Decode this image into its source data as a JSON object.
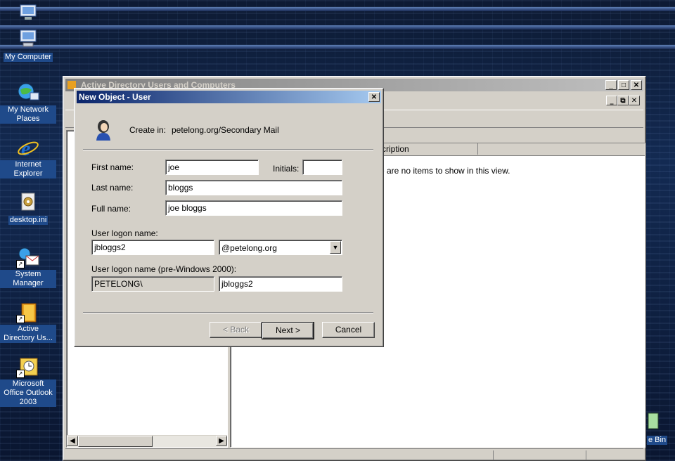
{
  "desktop": {
    "icons": [
      {
        "label": "My Computer"
      },
      {
        "label": "My Network Places"
      },
      {
        "label": "Internet Explorer"
      },
      {
        "label": "desktop.ini"
      },
      {
        "label": "System Manager"
      },
      {
        "label": "Active Directory Us..."
      },
      {
        "label": "Microsoft Office Outlook 2003"
      },
      {
        "label": "e Bin"
      }
    ]
  },
  "mmc": {
    "title": "Active Directory Users and Computers",
    "column_header": "scription",
    "empty_message": "re are no items to show in this view."
  },
  "dialog": {
    "title": "New Object - User",
    "create_in_label": "Create in:",
    "create_in_value": "petelong.org/Secondary Mail",
    "first_name_label": "First name:",
    "first_name_value": "joe",
    "initials_label": "Initials:",
    "initials_value": "",
    "last_name_label": "Last name:",
    "last_name_value": "bloggs",
    "full_name_label": "Full name:",
    "full_name_value": "joe bloggs",
    "logon_label": "User logon name:",
    "logon_value": "jbloggs2",
    "domain_value": "@petelong.org",
    "prewin_label": "User logon name (pre-Windows 2000):",
    "prewin_domain": "PETELONG\\",
    "prewin_value": "jbloggs2",
    "back_label": "< Back",
    "next_label": "Next >",
    "cancel_label": "Cancel",
    "close_glyph": "✕"
  }
}
